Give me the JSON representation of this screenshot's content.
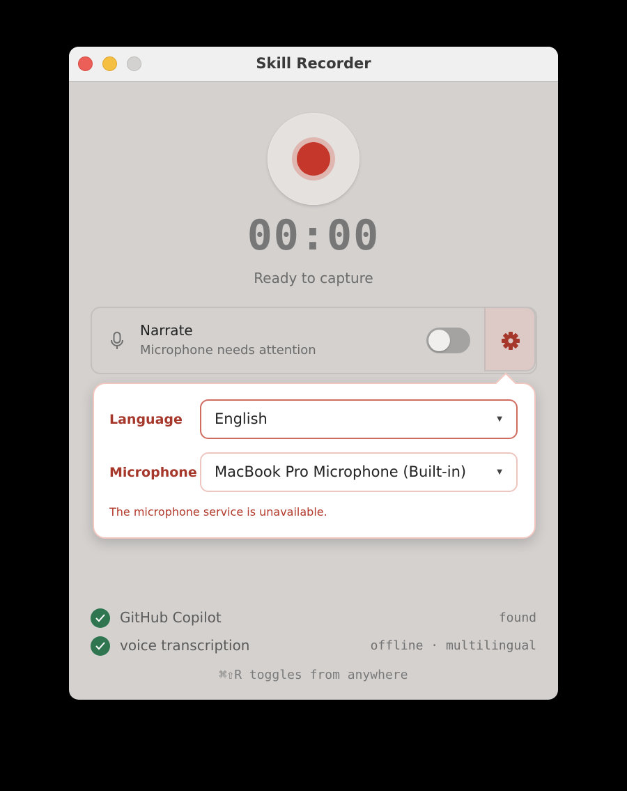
{
  "window": {
    "title": "Skill Recorder"
  },
  "recorder": {
    "timer": "00:00",
    "status": "Ready to capture"
  },
  "narrate": {
    "title": "Narrate",
    "subtitle": "Microphone needs attention",
    "enabled": false
  },
  "settings_popover": {
    "language_label": "Language",
    "language_value": "English",
    "microphone_label": "Microphone",
    "microphone_value": "MacBook Pro Microphone (Built-in)",
    "error": "The microphone service is unavailable."
  },
  "checks": [
    {
      "label": "GitHub Copilot",
      "status": "found"
    },
    {
      "label": "voice transcription",
      "status": "offline · multilingual"
    }
  ],
  "hint": "⌘⇧R toggles from anywhere",
  "colors": {
    "accent_red": "#c4372a",
    "error_red": "#b23a2c",
    "check_green": "#2e7550"
  }
}
